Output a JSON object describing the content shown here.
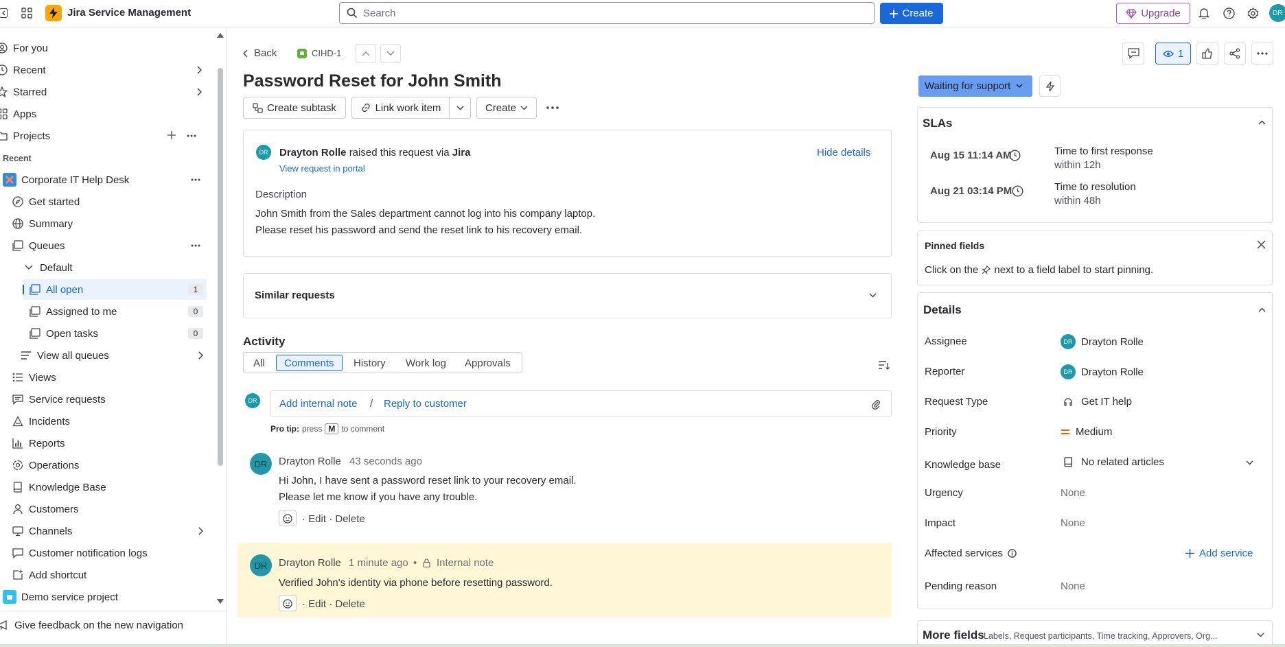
{
  "topbar": {
    "app_name": "Jira Service Management",
    "search_placeholder": "Search",
    "create_label": "Create",
    "upgrade_label": "Upgrade"
  },
  "sidebar": {
    "top_items": [
      "For you",
      "Recent",
      "Starred",
      "Apps",
      "Projects"
    ],
    "recent_label": "Recent",
    "project_name": "Corporate IT Help Desk",
    "items": {
      "get_started": "Get started",
      "summary": "Summary",
      "queues": "Queues",
      "default": "Default",
      "all_open": "All open",
      "all_open_count": "1",
      "assigned": "Assigned to me",
      "assigned_count": "0",
      "open_tasks": "Open tasks",
      "open_tasks_count": "0",
      "view_all_queues": "View all queues",
      "views": "Views",
      "service_requests": "Service requests",
      "incidents": "Incidents",
      "reports": "Reports",
      "operations": "Operations",
      "knowledge_base": "Knowledge Base",
      "customers": "Customers",
      "channels": "Channels",
      "notification_logs": "Customer notification logs",
      "add_shortcut": "Add shortcut",
      "demo_project": "Demo service project"
    },
    "feedback": "Give feedback on the new navigation"
  },
  "issue": {
    "back": "Back",
    "key": "CIHD-1",
    "title": "Password Reset for John Smith",
    "create_subtask": "Create subtask",
    "link_work_item": "Link work item",
    "create": "Create",
    "reporter_initials": "DR",
    "reporter_name": "Drayton Rolle",
    "raised_text": "raised this request via",
    "raised_via": "Jira",
    "view_in_portal": "View request in portal",
    "hide_details": "Hide details",
    "description_label": "Description",
    "description_lines": [
      "John Smith from the Sales department cannot log into his company laptop.",
      "Please reset his password and send the reset link to his recovery email."
    ],
    "similar_requests": "Similar requests"
  },
  "activity": {
    "heading": "Activity",
    "tabs": [
      "All",
      "Comments",
      "History",
      "Work log",
      "Approvals"
    ],
    "active_tab": "Comments",
    "add_internal_note": "Add internal note",
    "separator": "/",
    "reply_to_customer": "Reply to customer",
    "pro_tip_label": "Pro tip:",
    "pro_tip_press": "press",
    "pro_tip_key": "M",
    "pro_tip_rest": "to comment",
    "comments": [
      {
        "initials": "DR",
        "author": "Drayton Rolle",
        "time": "43 seconds ago",
        "lines": [
          "Hi John, I have sent a password reset link to your recovery email.",
          "Please let me know if you have any trouble."
        ],
        "edit": "Edit",
        "delete": "Delete"
      },
      {
        "initials": "DR",
        "author": "Drayton Rolle",
        "time": "1 minute ago",
        "tag": "Internal note",
        "lines": [
          "Verified John's identity via phone before resetting password."
        ],
        "edit": "Edit",
        "delete": "Delete"
      }
    ]
  },
  "right": {
    "watchers": "1",
    "status": "Waiting for support",
    "slas_title": "SLAs",
    "slas": [
      {
        "date": "Aug 15 11:14 AM",
        "title": "Time to first response",
        "sub": "within 12h"
      },
      {
        "date": "Aug 21 03:14 PM",
        "title": "Time to resolution",
        "sub": "within 48h"
      }
    ],
    "pinned_title": "Pinned fields",
    "pinned_hint_a": "Click on the",
    "pinned_hint_b": "next to a field label to start pinning.",
    "details_title": "Details",
    "fields": {
      "assignee_label": "Assignee",
      "assignee_value": "Drayton Rolle",
      "reporter_label": "Reporter",
      "reporter_value": "Drayton Rolle",
      "request_type_label": "Request Type",
      "request_type_value": "Get IT help",
      "priority_label": "Priority",
      "priority_value": "Medium",
      "kb_label": "Knowledge base",
      "kb_value": "No related articles",
      "urgency_label": "Urgency",
      "urgency_value": "None",
      "impact_label": "Impact",
      "impact_value": "None",
      "affected_label": "Affected services",
      "add_service": "Add service",
      "pending_label": "Pending reason",
      "pending_value": "None",
      "avatar_initials": "DR"
    },
    "more_fields_title": "More fields",
    "more_fields_sub": "Labels, Request participants, Time tracking, Approvers, Org..."
  },
  "colors": {
    "accent": "#1868db",
    "status_bg": "#669df1",
    "internal_bg": "#fff7d6",
    "priority": "#e06c00"
  }
}
